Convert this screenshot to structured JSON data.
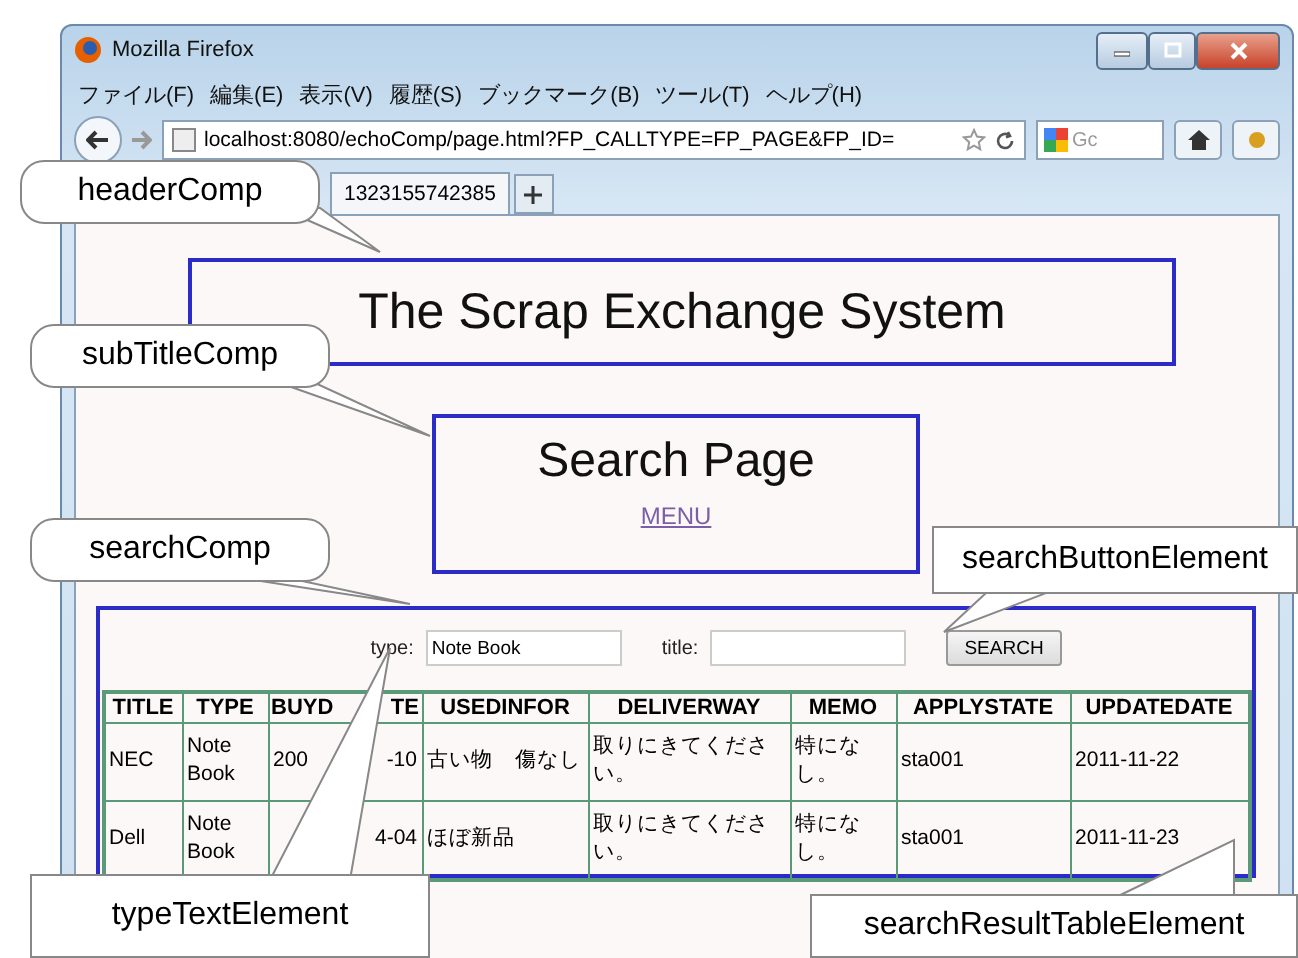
{
  "window": {
    "title": "Mozilla Firefox"
  },
  "menu": [
    "ファイル(F)",
    "編集(E)",
    "表示(V)",
    "履歴(S)",
    "ブックマーク(B)",
    "ツール(T)",
    "ヘルプ(H)"
  ],
  "address": {
    "url": "localhost:8080/echoComp/page.html?FP_CALLTYPE=FP_PAGE&FP_ID="
  },
  "search_field": {
    "placeholder": "Gc"
  },
  "tab": {
    "label": "1323155742385"
  },
  "page": {
    "header": "The Scrap Exchange System",
    "subtitle": "Search Page",
    "menu_link": "MENU",
    "search": {
      "type_label": "type:",
      "type_value": "Note Book",
      "title_label": "title:",
      "button": "SEARCH"
    },
    "table": {
      "columns": [
        {
          "label": "TITLE"
        },
        {
          "label": "TYPE"
        },
        {
          "start": "BUYD",
          "end": "TE"
        },
        {
          "label": "USEDINFOR"
        },
        {
          "label": "DELIVERWAY"
        },
        {
          "label": "MEMO"
        },
        {
          "label": "APPLYSTATE"
        },
        {
          "label": "UPDATEDATE"
        }
      ],
      "rows": [
        [
          "NEC",
          "Note Book",
          {
            "start": "200",
            "end": "-10"
          },
          "古い物　傷なし",
          "取りにきてください。",
          "特になし。",
          "sta001",
          "2011-11-22"
        ],
        [
          "Dell",
          "Note Book",
          {
            "end": "4-04"
          },
          "ほぼ新品",
          "取りにきてください。",
          "特になし。",
          "sta001",
          "2011-11-23"
        ]
      ]
    }
  },
  "callouts": [
    "headerComp",
    "subTitleComp",
    "searchComp",
    "searchButtonElement",
    "typeTextElement",
    "searchResultTableElement"
  ]
}
